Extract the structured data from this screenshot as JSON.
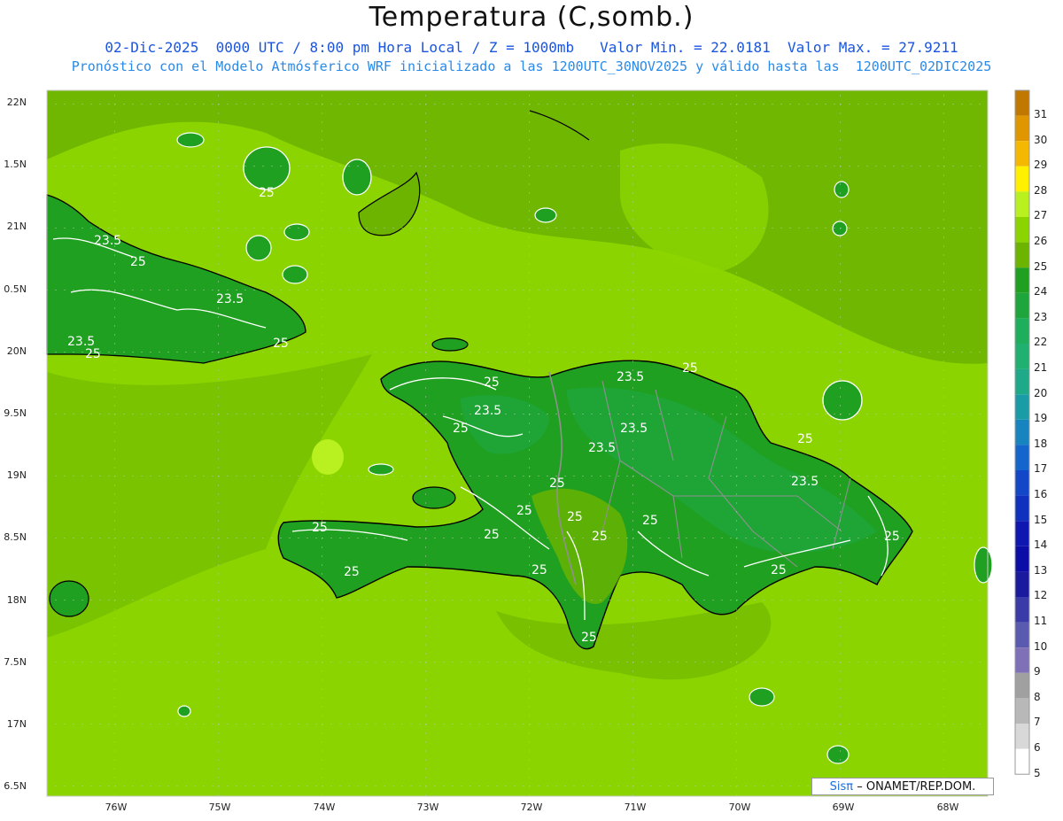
{
  "header": {
    "title": "Temperatura (C,somb.)",
    "subtitle_line1": "02-Dic-2025  0000 UTC / 8:00 pm Hora Local / Z = 1000mb   Valor Min. = 22.0181  Valor Max. = 27.9211",
    "subtitle_line2": "Pronóstico con el Modelo Atmósferico WRF inicializado a las 1200UTC_30NOV2025 y válido hasta las  1200UTC_02DIC2025"
  },
  "axes": {
    "lat_labels": [
      "22N",
      "1.5N",
      "21N",
      "0.5N",
      "20N",
      "9.5N",
      "19N",
      "8.5N",
      "18N",
      "7.5N",
      "17N",
      "6.5N"
    ],
    "lon_labels": [
      "76W",
      "75W",
      "74W",
      "73W",
      "72W",
      "71W",
      "70W",
      "69W",
      "68W"
    ]
  },
  "colorbar": {
    "labels": [
      "31",
      "30",
      "29",
      "28",
      "27",
      "26",
      "25",
      "24",
      "23",
      "22",
      "21",
      "20",
      "19",
      "18",
      "17",
      "16",
      "15",
      "14",
      "13",
      "12",
      "11",
      "10",
      "9",
      "8",
      "7",
      "6",
      "5"
    ],
    "colors": [
      "#c07800",
      "#e09600",
      "#f5b800",
      "#fff000",
      "#b8f020",
      "#8cd400",
      "#6cb400",
      "#20a020",
      "#1ea63c",
      "#1fae5c",
      "#20b06f",
      "#1eaa88",
      "#1a9ca6",
      "#1784c0",
      "#1466cc",
      "#1248c8",
      "#1030be",
      "#0e18b0",
      "#0c0ca6",
      "#1a1a9e",
      "#3a3aa8",
      "#5a5ab0",
      "#8070b8",
      "#a0a0a0",
      "#b8b8b8",
      "#d8d8d8",
      "#ffffff"
    ]
  },
  "contour_labels": [
    "23.5",
    "25",
    "23.5",
    "25",
    "23.5",
    "25",
    "25",
    "23.5",
    "25",
    "25",
    "23.5",
    "23.5",
    "23.5",
    "25",
    "25",
    "25",
    "25",
    "25",
    "23.5",
    "25",
    "25",
    "25",
    "25",
    "25",
    "25",
    "25",
    "25",
    "25",
    "25",
    "25"
  ],
  "credit": {
    "brand": "Sisπ",
    "text": "– ONAMET/REP.DOM."
  },
  "colors": {
    "sea": "#8cd400",
    "land_warm": "#6cb400",
    "land_cool": "#20a020",
    "highlands": "#1ea63c",
    "coast": "#000000",
    "border": "#909090"
  }
}
